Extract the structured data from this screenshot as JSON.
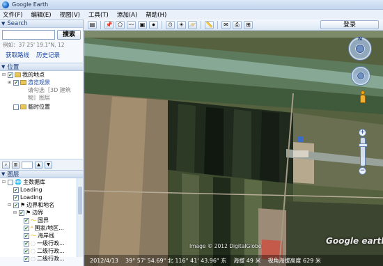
{
  "window": {
    "title": "Google Earth"
  },
  "menu": [
    "文件(F)",
    "编辑(E)",
    "视图(V)",
    "工具(T)",
    "添加(A)",
    "帮助(H)"
  ],
  "toolbar": {
    "icons": [
      "sidebar-toggle",
      "placemark",
      "polygon",
      "path",
      "image-overlay",
      "tour",
      "historical-imagery",
      "sunlight",
      "planets",
      "ruler",
      "email",
      "print",
      "view-in-maps"
    ],
    "login_label": "登录"
  },
  "search": {
    "header": "Search",
    "button": "搜索",
    "hint": "例如：37 25' 19.1\"N, 12",
    "links": [
      "获取路线",
      "历史记录"
    ]
  },
  "places": {
    "header": "位置",
    "items": [
      {
        "label": "我的地点",
        "checked": true,
        "expand": "−"
      },
      {
        "label": "游览观景",
        "checked": true,
        "expand": "+",
        "link": true
      },
      {
        "label": "请勾选［3D 建筑",
        "note": true
      },
      {
        "label": "物］图层",
        "note": true
      },
      {
        "label": "临时位置",
        "checked": false,
        "expand": ""
      }
    ]
  },
  "layers": {
    "header": "图层",
    "items": [
      {
        "label": "主数据库",
        "checked": false,
        "expand": "−",
        "level": 0
      },
      {
        "label": "Loading",
        "checked": true,
        "level": 1
      },
      {
        "label": "Loading",
        "checked": true,
        "level": 1
      },
      {
        "label": "边界和地名",
        "checked": true,
        "expand": "−",
        "level": 1
      },
      {
        "label": "边界",
        "checked": true,
        "expand": "−",
        "level": 2
      },
      {
        "label": "国界",
        "checked": true,
        "level": 3
      },
      {
        "label": "国家/地区...",
        "checked": true,
        "level": 3
      },
      {
        "label": "海岸线",
        "checked": true,
        "level": 3
      },
      {
        "label": "一级行政...",
        "checked": true,
        "level": 3
      },
      {
        "label": "二级行政...",
        "checked": true,
        "level": 3
      },
      {
        "label": "二级行政...",
        "checked": true,
        "level": 3
      }
    ]
  },
  "map": {
    "copyright": "Image © 2012 DigitalGlobe",
    "watermark": "Google earth",
    "nav_north": "N"
  },
  "status": {
    "date": "2012/4/13",
    "coords": "39° 57' 54.69\" 北  116° 41' 43.96\" 东",
    "elevation": "海拔  49 米",
    "eye_alt": "视角海拔高度  629 米"
  }
}
